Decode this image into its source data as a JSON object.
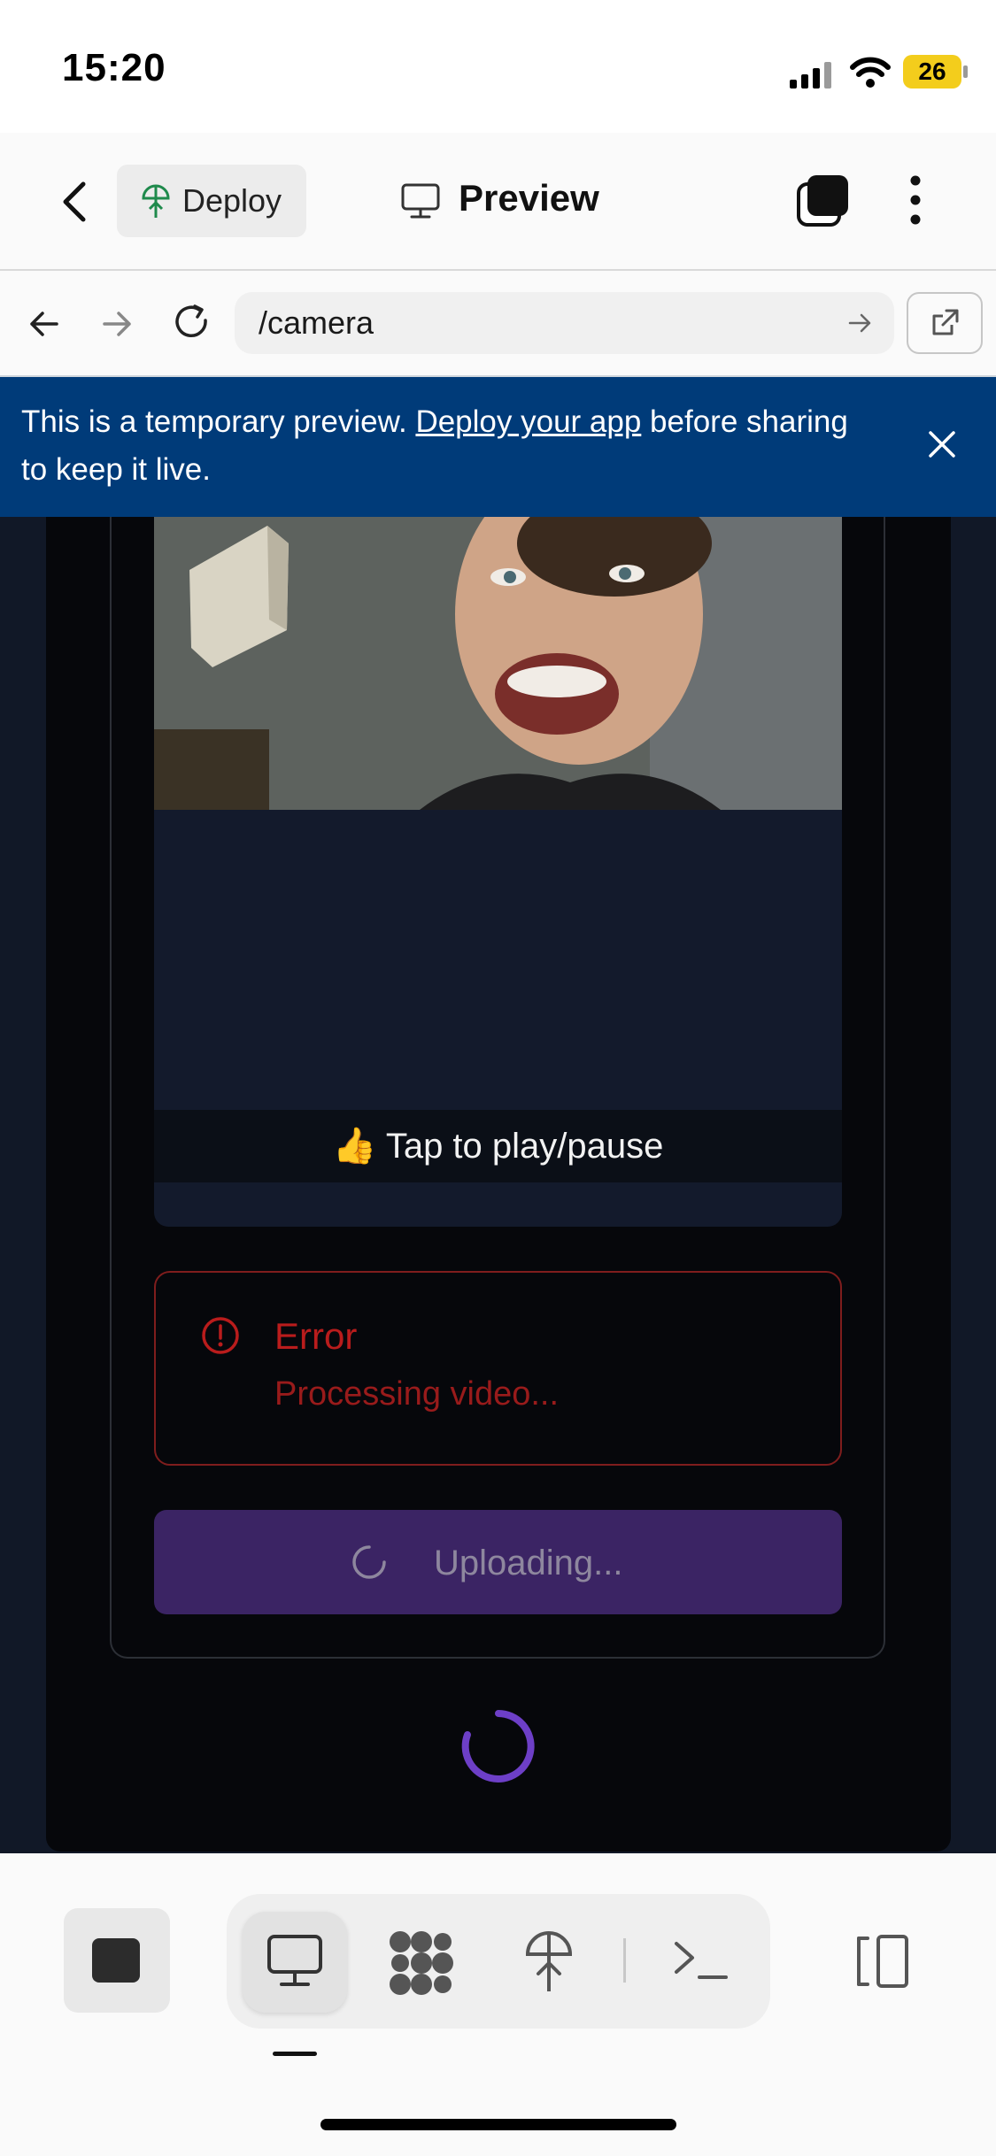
{
  "status_bar": {
    "time": "15:20",
    "battery": "26"
  },
  "header": {
    "deploy_label": "Deploy",
    "title": "Preview"
  },
  "browser": {
    "url": "/camera"
  },
  "banner": {
    "text_before": "This is a temporary preview. ",
    "link_text": "Deploy your app",
    "text_after": " before sharing to keep it live."
  },
  "video": {
    "hint": "👍 Tap to play/pause"
  },
  "error": {
    "title": "Error",
    "message": "Processing video..."
  },
  "upload_button": {
    "label": "Uploading..."
  },
  "colors": {
    "banner": "#003b79",
    "error": "#b91c1c",
    "upload_button": "#3b2464",
    "spinner": "#6d3fc7"
  }
}
